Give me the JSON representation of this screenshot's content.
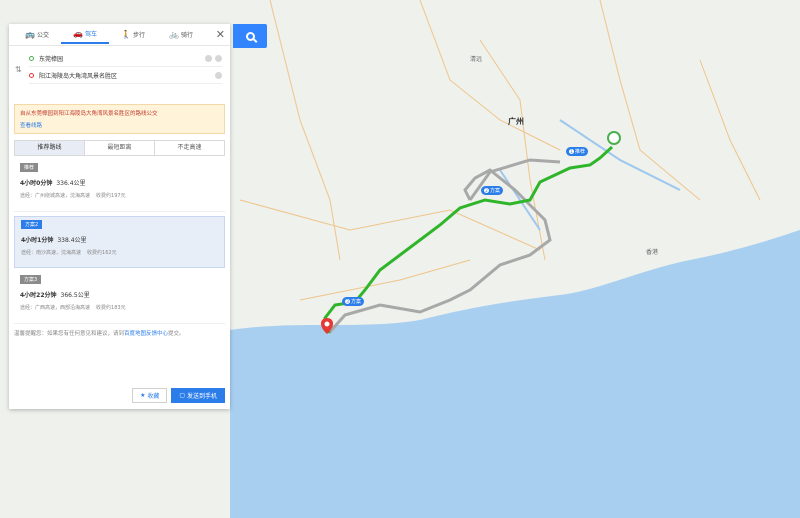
{
  "modes": [
    {
      "label": "公交",
      "icon": "bus-icon",
      "glyph": "🚌"
    },
    {
      "label": "驾车",
      "icon": "car-icon",
      "glyph": "🚗"
    },
    {
      "label": "步行",
      "icon": "walk-icon",
      "glyph": "🚶"
    },
    {
      "label": "骑行",
      "icon": "bike-icon",
      "glyph": "🚲"
    }
  ],
  "start": "东莞樟园",
  "end": "阳江海陵岛大角湾风景名胜区",
  "notice": {
    "warning": "自从东莞樟园到阳江海陵岛大角湾风景名胜区的路线公交",
    "link": "查看线路"
  },
  "strategies": [
    "推荐路线",
    "最短距离",
    "不走高速"
  ],
  "plans": [
    {
      "tag": "推荐",
      "time": "4小时0分钟",
      "distance": "336.4公里",
      "via": "途经：广州绕城高速，沈海高速",
      "toll": "收费约197元",
      "active": false
    },
    {
      "tag": "方案2",
      "time": "4小时1分钟",
      "distance": "338.4公里",
      "via": "途经：南沙高速，沈海高速",
      "toll": "收费约162元",
      "active": true
    },
    {
      "tag": "方案3",
      "time": "4小时22分钟",
      "distance": "366.5公里",
      "via": "途经：广西高速，西部沿海高速",
      "toll": "收费约183元",
      "active": false
    }
  ],
  "tip": {
    "text": "温馨提醒您：如果您有任何意见和建议，请到",
    "link": "百度地图反馈中心",
    "suffix": "提交。"
  },
  "actions": {
    "favorite": "收藏",
    "send": "发送到手机"
  },
  "map_labels": {
    "guangzhou": "广州",
    "qingyuan": "清远",
    "hongkong": "香港",
    "route_1": "推荐",
    "route_2": "方案",
    "route_3": "方案"
  },
  "colors": {
    "accent": "#2b7de9",
    "route_main": "#2fb52a",
    "route_alt": "#a8a8a8",
    "sea": "#a8cff0"
  }
}
